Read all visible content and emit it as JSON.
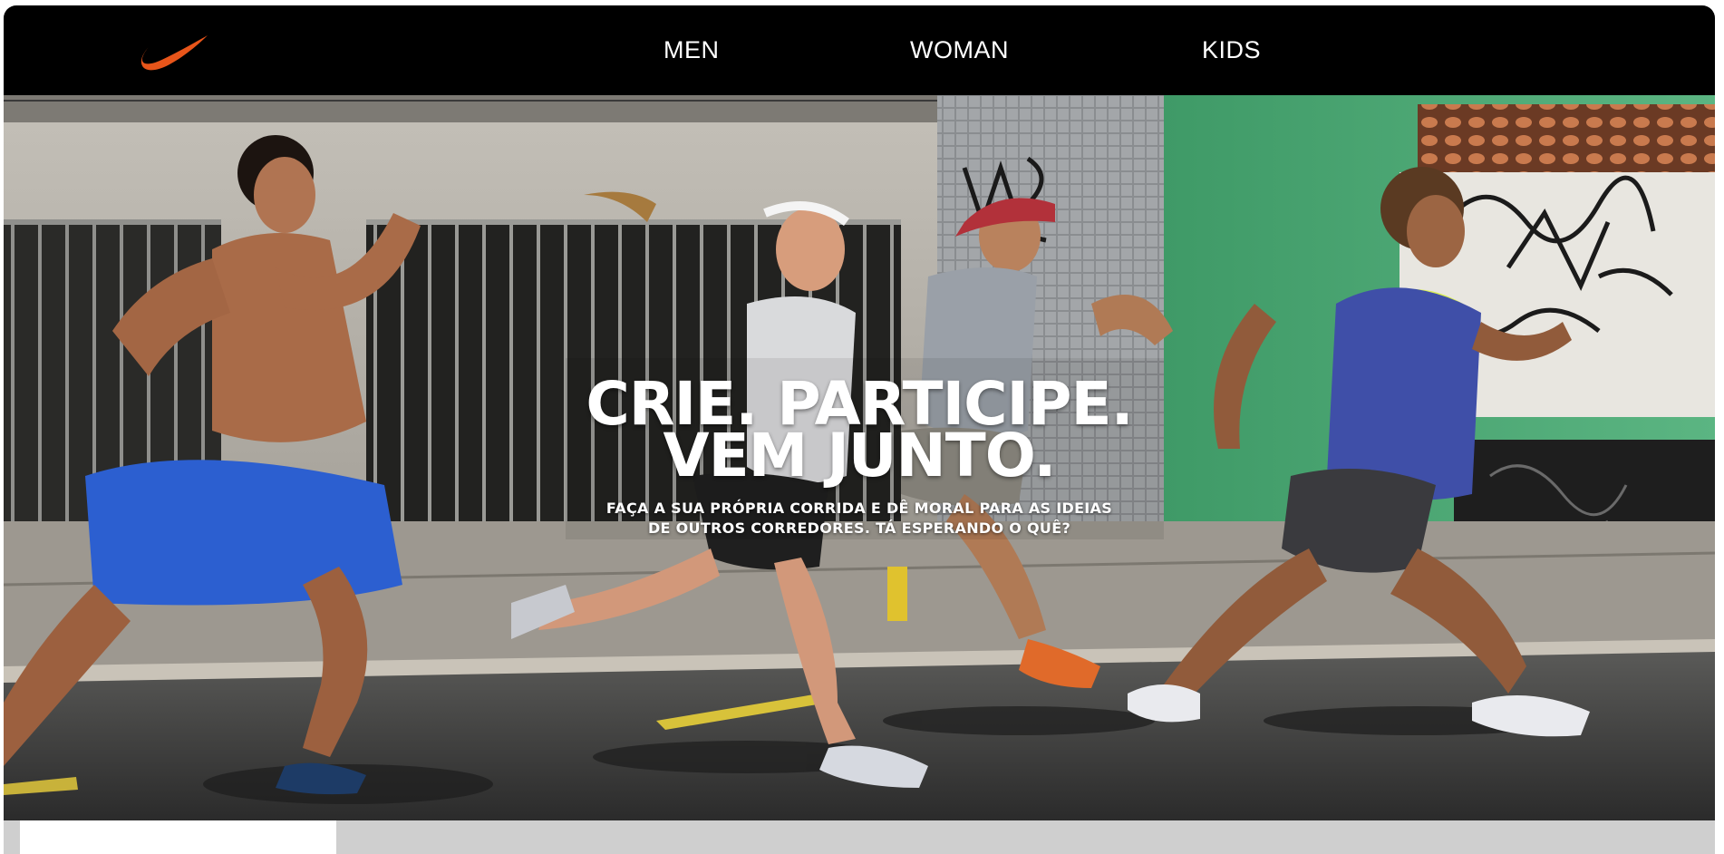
{
  "header": {
    "logo_icon": "swoosh-icon",
    "logo_color": "#e8551a",
    "nav": [
      {
        "label": "MEN"
      },
      {
        "label": "WOMAN"
      },
      {
        "label": "KIDS"
      }
    ]
  },
  "hero": {
    "headline_line1": "CRIE. PARTICIPE.",
    "headline_line2": "VEM JUNTO.",
    "tagline_line1": "FAÇA A SUA PRÓPRIA CORRIDA E DÊ MORAL PARA AS IDEIAS",
    "tagline_line2": "DE OUTROS CORREDORES. TÁ ESPERANDO O QUÊ?"
  },
  "colors": {
    "navbar_bg": "#000000",
    "nav_text": "#ffffff",
    "wall_gray": "#b9b5ae",
    "wall_green": "#4aa472",
    "street": "#3a3a3a",
    "accent_blue": "#2c5fd0",
    "accent_yellow": "#d9ef52"
  }
}
